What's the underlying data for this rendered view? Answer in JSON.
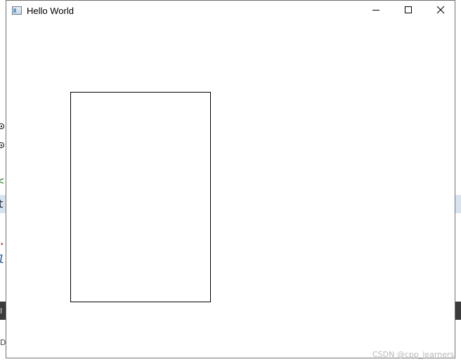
{
  "window": {
    "title": "Hello World",
    "icon": "app-window-icon",
    "buttons": {
      "minimize": "minimize-icon",
      "maximize": "maximize-icon",
      "close": "close-icon"
    }
  },
  "canvas": {
    "shape": "rectangle",
    "stroke_color": "#000000",
    "fill": "none"
  },
  "watermark": "CSDN @cpp_learners",
  "colors": {
    "window_border": "#707070",
    "background": "#ffffff",
    "editor_highlight": "#d6e4f2"
  }
}
